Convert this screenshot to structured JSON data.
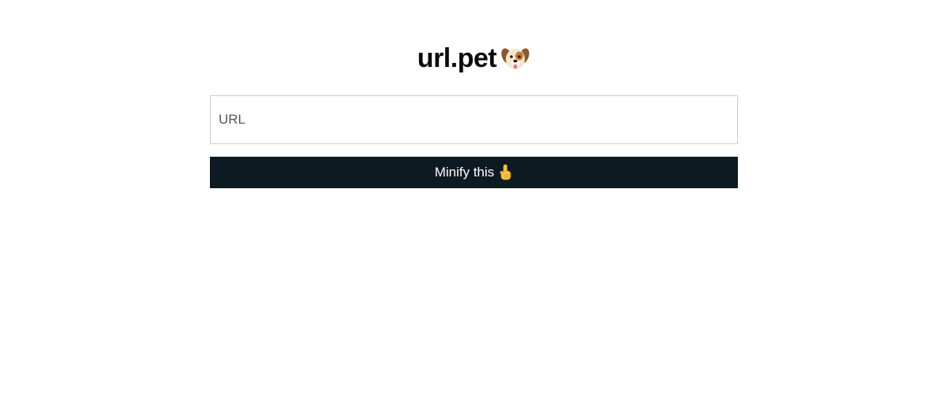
{
  "header": {
    "title": "url.pet",
    "icon": "dog-face-icon"
  },
  "form": {
    "url_placeholder": "URL",
    "url_value": "",
    "submit_label": "Minify this",
    "submit_icon": "pointing-up-icon"
  },
  "colors": {
    "button_background": "#0d1a21",
    "button_text": "#ffffff",
    "title_text": "#0b0b0b",
    "input_border": "#cccccc"
  }
}
